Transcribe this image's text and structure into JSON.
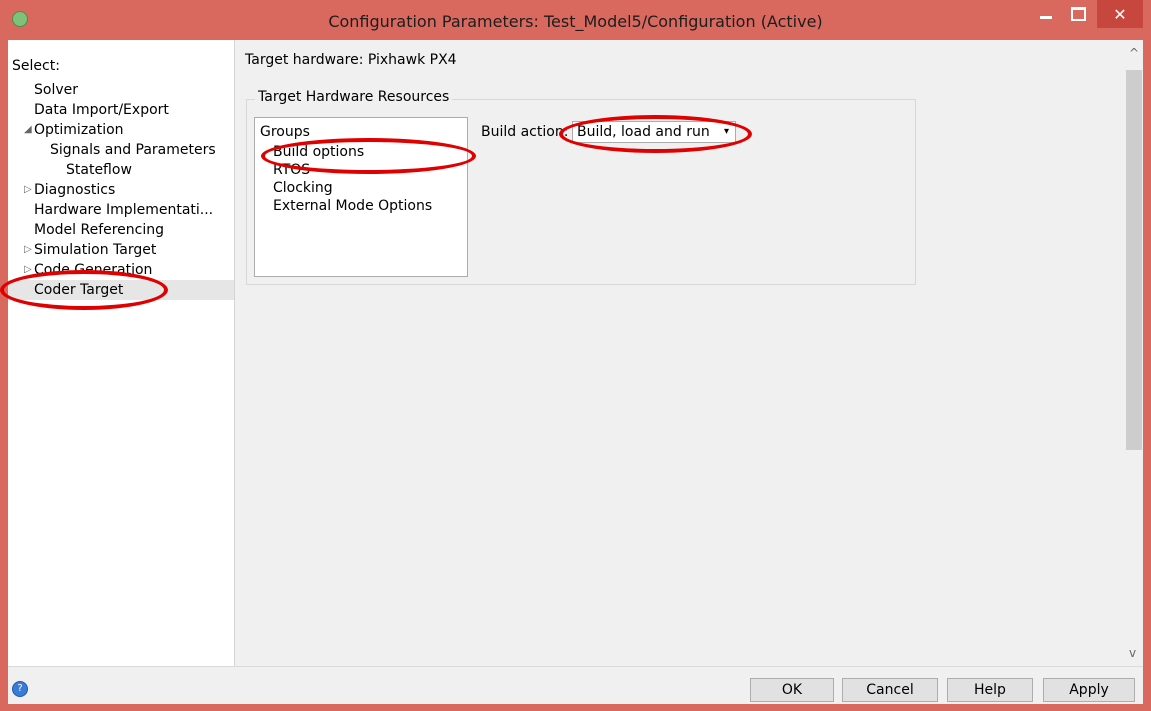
{
  "window": {
    "title": "Configuration Parameters: Test_Model5/Configuration (Active)",
    "close_glyph": "✕"
  },
  "sidebar": {
    "select_label": "Select:",
    "items": [
      {
        "label": "Solver"
      },
      {
        "label": "Data Import/Export"
      },
      {
        "label": "Optimization",
        "expander": "◢"
      },
      {
        "label": "Signals and Parameters"
      },
      {
        "label": "Stateflow"
      },
      {
        "label": "Diagnostics",
        "expander": "▷"
      },
      {
        "label": "Hardware Implementati..."
      },
      {
        "label": "Model Referencing"
      },
      {
        "label": "Simulation Target",
        "expander": "▷"
      },
      {
        "label": "Code Generation",
        "expander": "▷"
      },
      {
        "label": "Coder Target"
      }
    ]
  },
  "main": {
    "target_hardware": "Target hardware: Pixhawk PX4",
    "group_title": "Target Hardware Resources",
    "groups_header": "Groups",
    "groups": [
      "Build options",
      "RTOS",
      "Clocking",
      "External Mode Options"
    ],
    "build_action_label": "Build action:",
    "build_action_value": "Build, load and run",
    "dropdown_arrow": "▾"
  },
  "scroll": {
    "up": "^",
    "down": "v"
  },
  "buttons": {
    "ok": "OK",
    "cancel": "Cancel",
    "help": "Help",
    "apply": "Apply"
  },
  "help_icon_glyph": "?",
  "annotation_color": "#e00000",
  "title_bar_color": "#d9695f"
}
